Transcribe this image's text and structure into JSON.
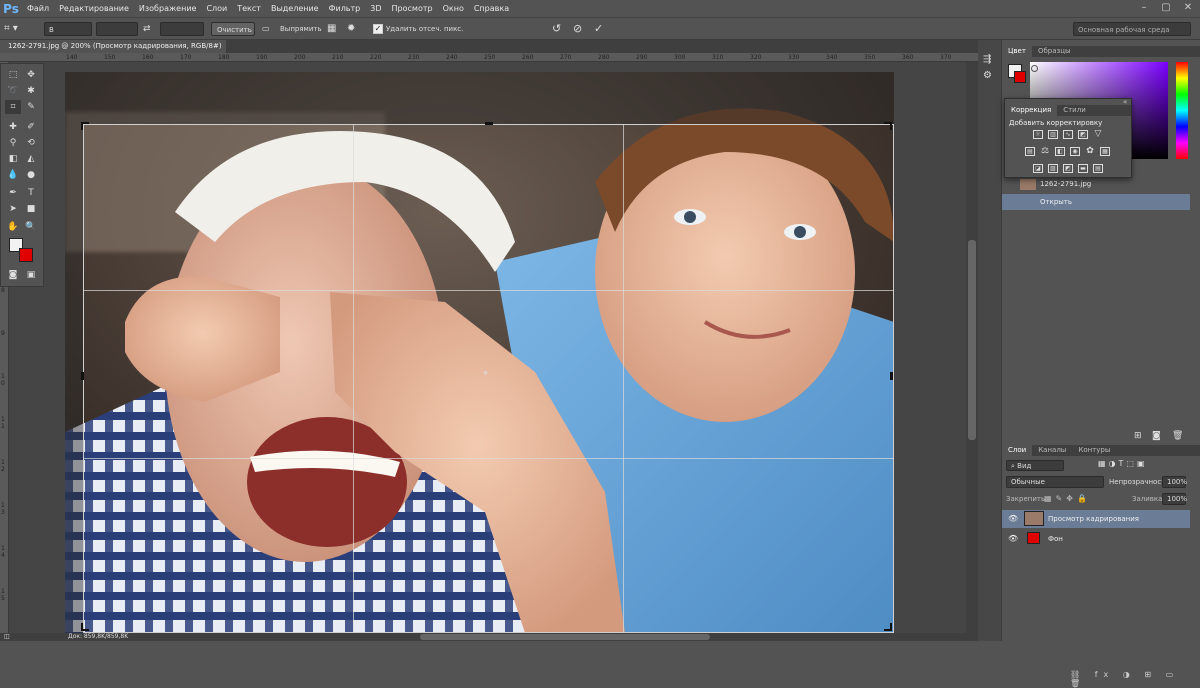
{
  "app": {
    "logo": "Ps"
  },
  "menu": [
    "Файл",
    "Редактирование",
    "Изображение",
    "Слои",
    "Текст",
    "Выделение",
    "Фильтр",
    "3D",
    "Просмотр",
    "Окно",
    "Справка"
  ],
  "options": {
    "ratio_select": "В соотно...",
    "clear_button": "Очистить",
    "straighten_button": "Выпрямить",
    "delete_cropped_checkbox": "Удалить отсеч. пикс.",
    "workspace_select": "Основная рабочая среда"
  },
  "document": {
    "tab_title": "1262-2791.jpg @ 200% (Просмотр кадрирования, RGB/8#)",
    "tab_close": "×",
    "status": "Док: 859,8K/859,8K"
  },
  "rulers": {
    "horizontal": [
      "140",
      "150",
      "160",
      "170",
      "180",
      "190",
      "200",
      "210",
      "220",
      "230",
      "240",
      "250",
      "260",
      "270",
      "280",
      "290",
      "300",
      "310",
      "320",
      "330",
      "340",
      "350",
      "360",
      "370",
      "380"
    ],
    "vertical": [
      "3",
      "4",
      "5",
      "6",
      "7",
      "8",
      "9",
      "1 0",
      "1 1",
      "1 2",
      "1 3",
      "1 4",
      "1 5"
    ]
  },
  "color_panel": {
    "tabs": [
      "Цвет",
      "Образцы"
    ],
    "foreground": "#f2f2f2",
    "background": "#e00000"
  },
  "adjustments_panel": {
    "tabs": [
      "Коррекция",
      "Стили"
    ],
    "heading": "Добавить корректировку"
  },
  "history_panel": {
    "items": [
      {
        "label": "1262-2791.jpg"
      },
      {
        "label": "Открыть"
      }
    ]
  },
  "layers_panel": {
    "tabs": [
      "Слои",
      "Каналы",
      "Контуры"
    ],
    "filter_select": "Вид",
    "blend_mode": "Обычные",
    "opacity_label": "Непрозрачность:",
    "opacity_value": "100%",
    "lock_label": "Закрепить:",
    "fill_label": "Заливка:",
    "fill_value": "100%",
    "layers": [
      {
        "name": "Просмотр кадрирования",
        "selected": true
      },
      {
        "name": "Фон",
        "selected": false
      }
    ]
  },
  "colors": {
    "accent": "#6a7c96",
    "panel": "#535353",
    "dark": "#3f3f3f"
  }
}
